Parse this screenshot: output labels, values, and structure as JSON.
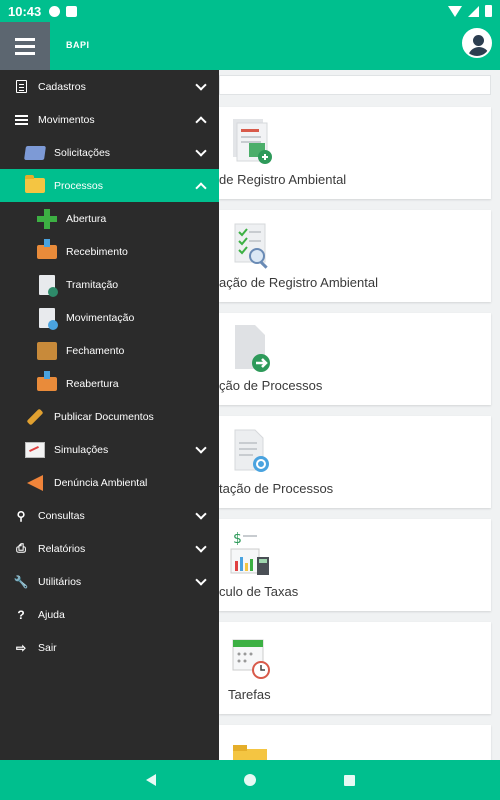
{
  "status": {
    "time": "10:43"
  },
  "appbar": {
    "logo": "BAPI"
  },
  "drawer": {
    "cadastros": "Cadastros",
    "movimentos": "Movimentos",
    "solicitacoes": "Solicitações",
    "processos": "Processos",
    "abertura": "Abertura",
    "recebimento": "Recebimento",
    "tramitacao": "Tramitação",
    "movimentacao": "Movimentação",
    "fechamento": "Fechamento",
    "reabertura": "Reabertura",
    "publicar": "Publicar Documentos",
    "simulacoes": "Simulações",
    "denuncia": "Denúncia Ambiental",
    "consultas": "Consultas",
    "relatorios": "Relatórios",
    "utilitarios": "Utilitários",
    "ajuda": "Ajuda",
    "sair": "Sair"
  },
  "cards": [
    {
      "label": "de Registro Ambiental"
    },
    {
      "label": "ação de Registro Ambiental"
    },
    {
      "label": "ção de Processos"
    },
    {
      "label": "tação de Processos"
    },
    {
      "label": "culo de Taxas"
    },
    {
      "label": "Tarefas"
    }
  ],
  "colors": {
    "accent": "#00bf8e",
    "drawer": "#2b2b2b"
  }
}
